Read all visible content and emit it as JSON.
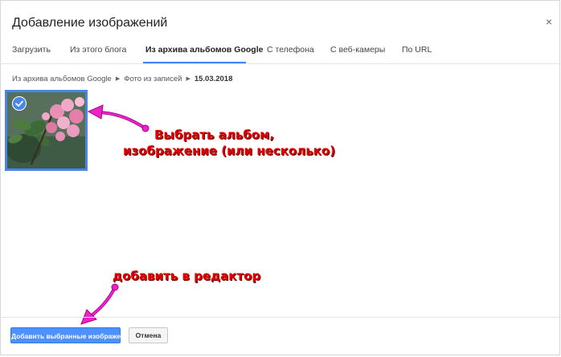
{
  "dialog": {
    "title": "Добавление изображений",
    "close_glyph": "×"
  },
  "tabs": [
    {
      "label": "Загрузить",
      "active": false
    },
    {
      "label": "Из этого блога",
      "active": false
    },
    {
      "label": "Из архива альбомов Google",
      "active": true
    },
    {
      "label": "С телефона",
      "active": false
    },
    {
      "label": "С веб-камеры",
      "active": false
    },
    {
      "label": "По URL",
      "active": false
    }
  ],
  "breadcrumb": {
    "items": [
      "Из архива альбомов Google",
      "Фото из записей",
      "15.03.2018"
    ]
  },
  "gallery": {
    "items": [
      {
        "selected": true,
        "icon": "check-icon"
      }
    ]
  },
  "annotations": {
    "select_line1": "Выбрать альбом,",
    "select_line2": "изображение (или несколько)",
    "add_to_editor": "добавить в редактор",
    "color": "#e00000",
    "arrow_color": "#ee22cc"
  },
  "footer": {
    "add_button": "Добавить выбранные изображения",
    "cancel_button": "Отмена"
  },
  "colors": {
    "accent": "#4285f4",
    "primary_button": "#4d90fe"
  }
}
